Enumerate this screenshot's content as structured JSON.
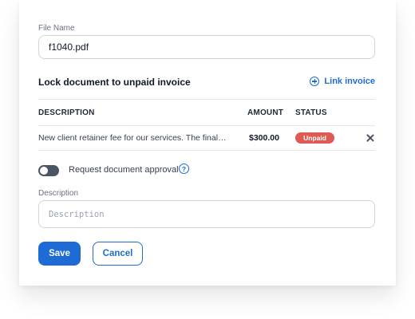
{
  "file_name": {
    "label": "File Name",
    "value": "f1040.pdf"
  },
  "lock_section": {
    "title": "Lock document to unpaid invoice",
    "link_invoice_label": "Link invoice",
    "link_icon": "plus-circle-icon"
  },
  "invoice_table": {
    "headers": {
      "description": "DESCRIPTION",
      "amount": "AMOUNT",
      "status": "STATUS"
    },
    "rows": [
      {
        "description": "New client retainer fee for our services. The final…",
        "amount": "$300.00",
        "status": "Unpaid",
        "status_color": "#e05a55"
      }
    ]
  },
  "approval": {
    "label": "Request document approval",
    "enabled": false,
    "help_icon": "question-circle-icon"
  },
  "description": {
    "label": "Description",
    "placeholder": "Description",
    "value": ""
  },
  "actions": {
    "save_label": "Save",
    "cancel_label": "Cancel"
  },
  "colors": {
    "accent": "#1e6bd6",
    "danger": "#e05a55",
    "toggle_off": "#4b5563"
  }
}
